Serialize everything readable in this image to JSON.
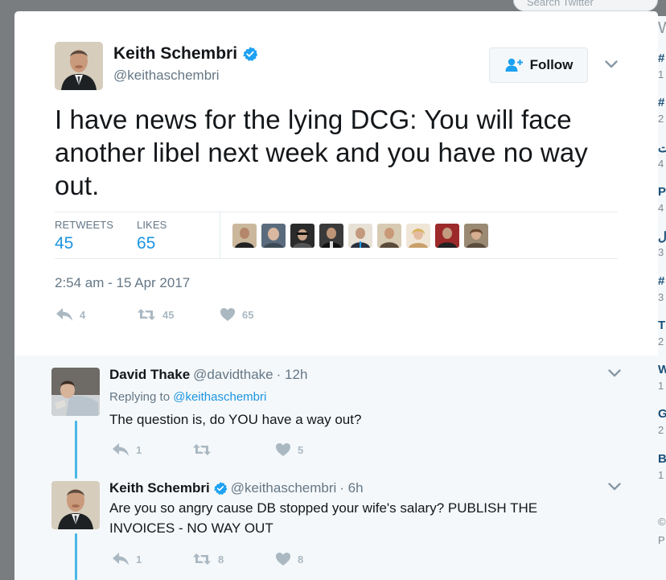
{
  "background": {
    "search_placeholder": "Search Twitter",
    "sidebar_heading": "W",
    "sidebar_trends": [
      {
        "tag": "#",
        "count": "1"
      },
      {
        "tag": "#",
        "count": "2"
      },
      {
        "tag": "ت",
        "count": "4"
      },
      {
        "tag": "P",
        "count": "4"
      },
      {
        "tag": "ل",
        "count": "3"
      },
      {
        "tag": "#",
        "count": "3"
      },
      {
        "tag": "T",
        "count": "2"
      },
      {
        "tag": "W",
        "count": "1"
      },
      {
        "tag": "G",
        "count": "2"
      },
      {
        "tag": "B",
        "count": "1"
      }
    ],
    "footer_fragments": [
      "©",
      "P"
    ]
  },
  "tweet": {
    "author_name": "Keith Schembri",
    "author_handle": "@keithaschembri",
    "follow_label": "Follow",
    "text": "I have news for the lying DCG: You will face another libel next week and you have no way out.",
    "retweets_label": "RETWEETS",
    "retweets_count": "45",
    "likes_label": "LIKES",
    "likes_count": "65",
    "timestamp": "2:54 am - 15 Apr 2017",
    "actions": {
      "reply_count": "4",
      "retweet_count": "45",
      "like_count": "65"
    }
  },
  "replies": [
    {
      "author_name": "David Thake",
      "author_handle": "@davidthake",
      "time": "· 12h",
      "replying_to_prefix": "Replying to",
      "replying_to_handle": "@keithaschembri",
      "text": "The question is, do YOU have a way out?",
      "reply_count": "1",
      "retweet_count": "",
      "like_count": "5"
    },
    {
      "author_name": "Keith Schembri",
      "author_handle": "@keithaschembri",
      "time": "· 6h",
      "text": "Are you so angry cause DB stopped your wife's salary? PUBLISH THE INVOICES - NO WAY OUT",
      "reply_count": "1",
      "retweet_count": "8",
      "like_count": "8"
    }
  ],
  "colors": {
    "link": "#1b95e0",
    "verified": "#1da1f2",
    "thread": "#49b7e6",
    "muted": "#657786",
    "icon": "#aab8c2"
  }
}
